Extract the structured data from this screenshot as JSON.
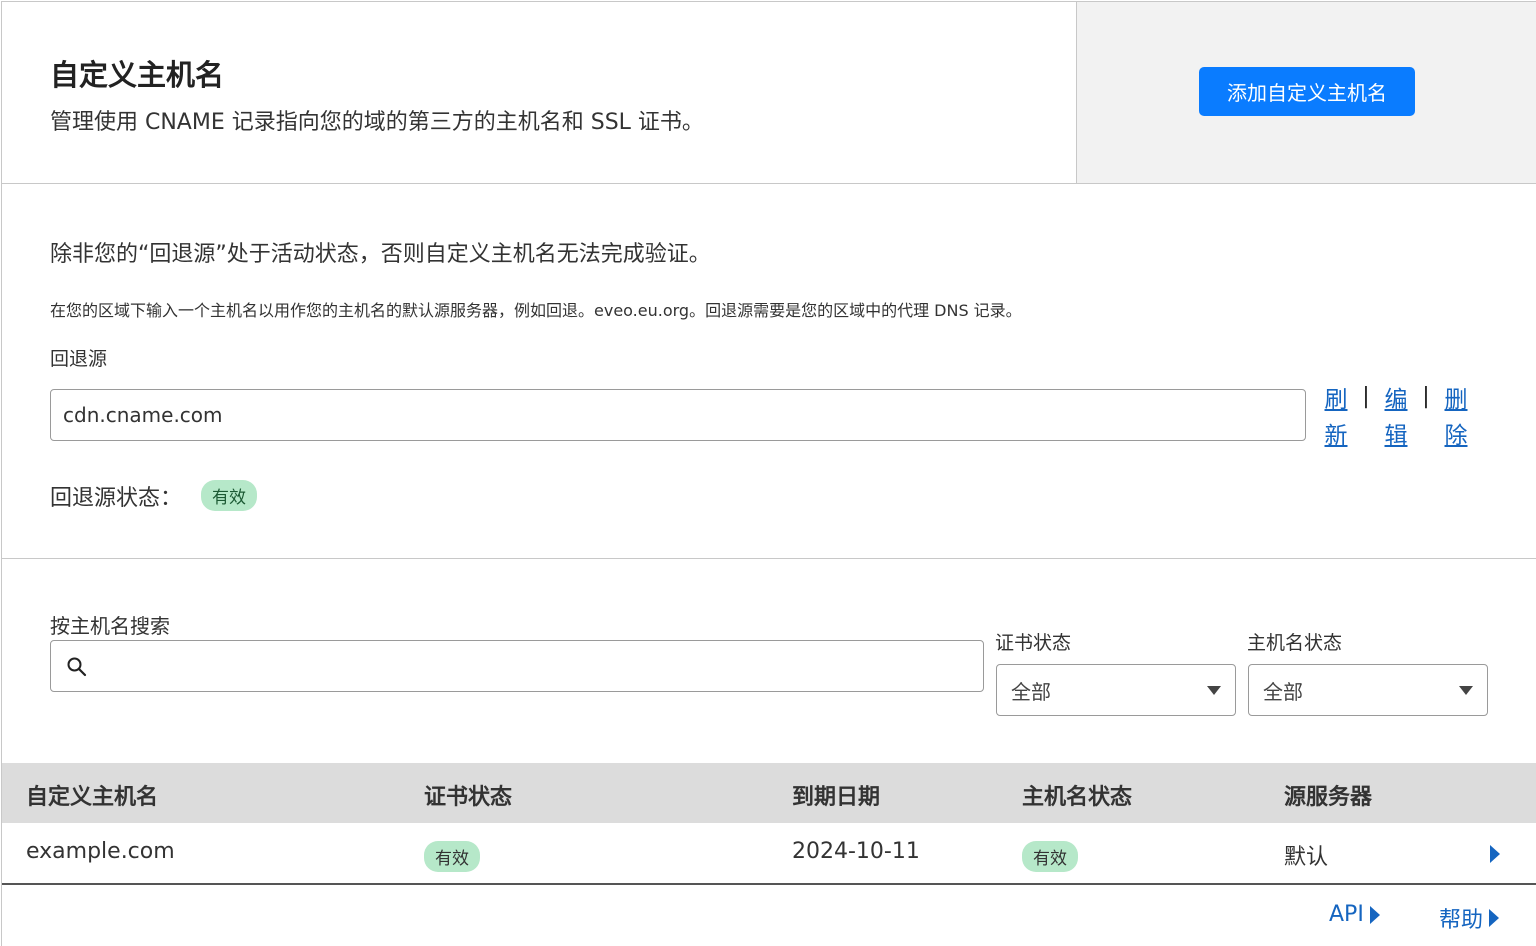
{
  "header": {
    "title": "自定义主机名",
    "subtitle": "管理使用 CNAME 记录指向您的域的第三方的主机名和 SSL 证书。",
    "add_button": "添加自定义主机名"
  },
  "fallback": {
    "warning": "除非您的“回退源”处于活动状态，否则自定义主机名无法完成验证。",
    "description": "在您的区域下输入一个主机名以用作您的主机名的默认源服务器，例如回退。eveo.eu.org。回退源需要是您的区域中的代理 DNS 记录。",
    "label": "回退源",
    "value": "cdn.cname.com",
    "actions": {
      "refresh": "刷新",
      "edit": "编辑",
      "delete": "删除",
      "separator": "|"
    },
    "status_label": "回退源状态：",
    "status": "有效"
  },
  "filters": {
    "search_label": "按主机名搜索",
    "search_placeholder": "",
    "cert_status_label": "证书状态",
    "cert_status_value": "全部",
    "hostname_status_label": "主机名状态",
    "hostname_status_value": "全部"
  },
  "table": {
    "columns": [
      "自定义主机名",
      "证书状态",
      "到期日期",
      "主机名状态",
      "源服务器"
    ],
    "rows": [
      {
        "hostname": "example.com",
        "cert_status": "有效",
        "expiry": "2024-10-11",
        "hostname_status": "有效",
        "origin": "默认"
      }
    ]
  },
  "footer": {
    "api": "API",
    "help": "帮助"
  },
  "colors": {
    "primary": "#0a7cff",
    "link": "#1565c0",
    "badge_bg": "#b6e8c9",
    "header_gray": "#f2f2f2",
    "table_header": "#dcdcdc"
  }
}
